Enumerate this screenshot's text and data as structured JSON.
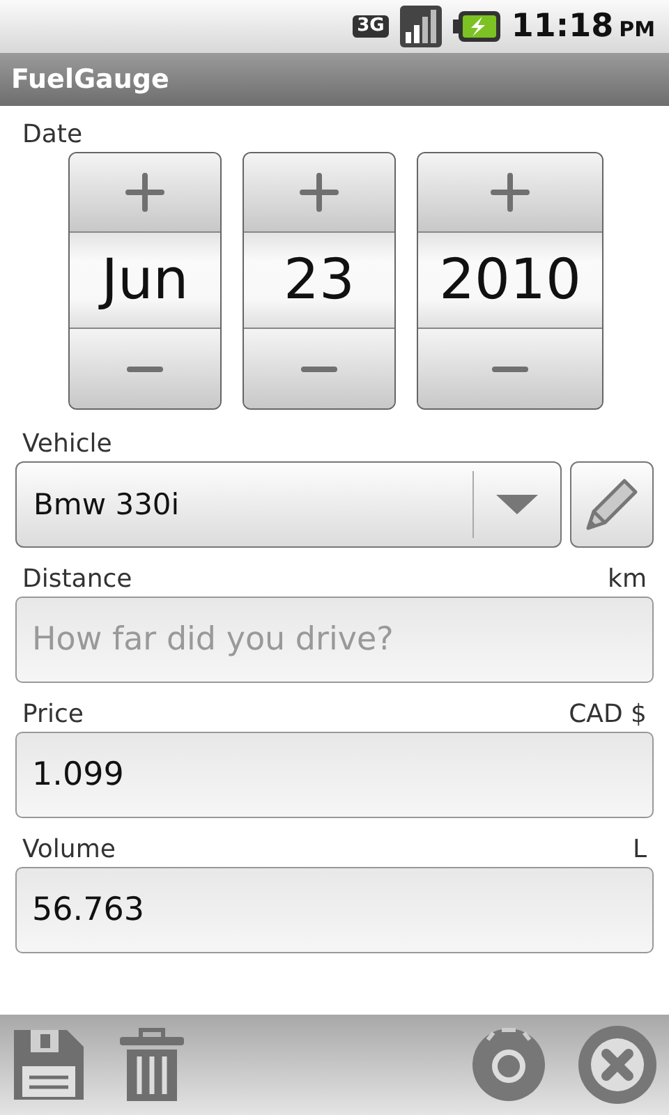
{
  "status_bar": {
    "network_type": "3G",
    "time": "11:18",
    "am_pm": "PM"
  },
  "title_bar": {
    "title": "FuelGauge"
  },
  "date": {
    "label": "Date",
    "pickers": [
      {
        "value": "Jun"
      },
      {
        "value": "23"
      },
      {
        "value": "2010"
      }
    ]
  },
  "vehicle": {
    "label": "Vehicle",
    "value": "Bmw 330i"
  },
  "fields": [
    {
      "label": "Distance",
      "unit": "km",
      "placeholder": "How far did you drive?"
    },
    {
      "label": "Price",
      "unit": "CAD $",
      "value": "1.099"
    },
    {
      "label": "Volume",
      "unit": "L",
      "value": "56.763"
    }
  ]
}
